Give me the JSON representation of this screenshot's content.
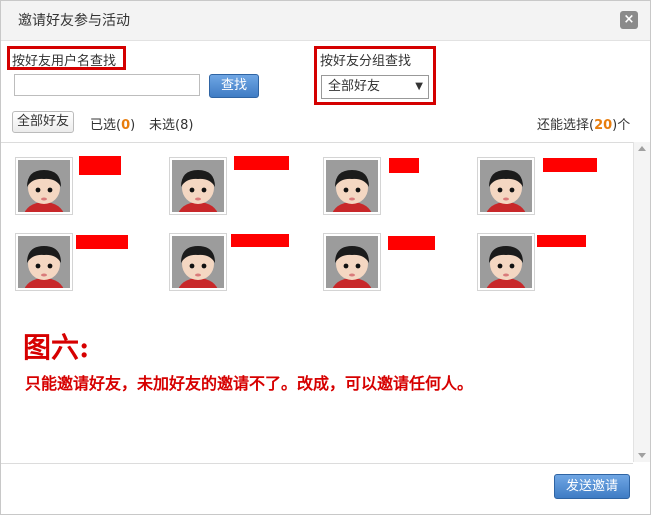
{
  "dialog": {
    "title": "邀请好友参与活动",
    "close_glyph": "×"
  },
  "search_by_name": {
    "label": "按好友用户名查找",
    "input_value": "",
    "button": "查找"
  },
  "search_by_group": {
    "label": "按好友分组查找",
    "selected": "全部好友",
    "arrow": "▼"
  },
  "filters": {
    "all": "全部好友",
    "selected_prefix": "已选(",
    "selected_count": "0",
    "selected_suffix": ")",
    "unselected": "未选(8)",
    "remaining_prefix": "还能选择(",
    "remaining_count": "20",
    "remaining_suffix": ")个"
  },
  "friends": [
    {
      "name": ""
    },
    {
      "name": ""
    },
    {
      "name": ""
    },
    {
      "name": ""
    },
    {
      "name": ""
    },
    {
      "name": ""
    },
    {
      "name": ""
    },
    {
      "name": ""
    }
  ],
  "annotation": {
    "title": "图六:",
    "body": "只能邀请好友，未加好友的邀请不了。改成，可以邀请任何人。"
  },
  "footer": {
    "send_button": "发送邀请"
  },
  "colors": {
    "accent": "#3f7cc4",
    "highlight": "#e87d0d",
    "annotation_red": "#d60000",
    "redaction": "#ff0000"
  }
}
